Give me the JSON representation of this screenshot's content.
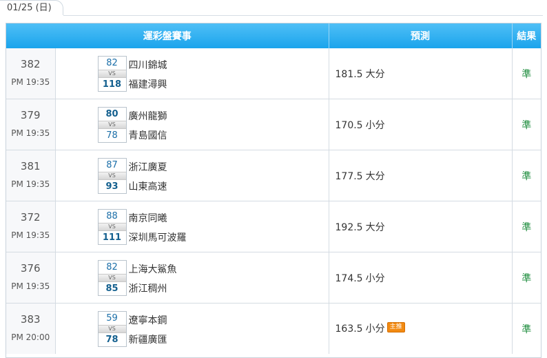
{
  "date_tab": "01/25 (日)",
  "header": {
    "event": "運彩盤賽事",
    "prediction": "預測",
    "result": "結果"
  },
  "vs_label": "VS",
  "rows": [
    {
      "game_id": "382",
      "time": "PM 19:35",
      "home_team": "四川錦城",
      "home_score": "82",
      "away_team": "福建潯興",
      "away_score": "118",
      "pred_value": "181.5",
      "pred_pick": "大分",
      "badge": "",
      "result": "準"
    },
    {
      "game_id": "379",
      "time": "PM 19:35",
      "home_team": "廣州龍獅",
      "home_score": "80",
      "away_team": "青島國信",
      "away_score": "78",
      "pred_value": "170.5",
      "pred_pick": "小分",
      "badge": "",
      "result": "準"
    },
    {
      "game_id": "381",
      "time": "PM 19:35",
      "home_team": "浙江廣夏",
      "home_score": "87",
      "away_team": "山東高速",
      "away_score": "93",
      "pred_value": "177.5",
      "pred_pick": "大分",
      "badge": "",
      "result": "準"
    },
    {
      "game_id": "372",
      "time": "PM 19:35",
      "home_team": "南京同曦",
      "home_score": "88",
      "away_team": "深圳馬可波羅",
      "away_score": "111",
      "pred_value": "192.5",
      "pred_pick": "大分",
      "badge": "",
      "result": "準"
    },
    {
      "game_id": "376",
      "time": "PM 19:35",
      "home_team": "上海大鯊魚",
      "home_score": "82",
      "away_team": "浙江稠州",
      "away_score": "85",
      "pred_value": "174.5",
      "pred_pick": "小分",
      "badge": "",
      "result": "準"
    },
    {
      "game_id": "383",
      "time": "PM 20:00",
      "home_team": "遼寧本鋼",
      "home_score": "59",
      "away_team": "新疆廣匯",
      "away_score": "78",
      "pred_value": "163.5",
      "pred_pick": "小分",
      "badge": "主推",
      "result": "準"
    }
  ]
}
